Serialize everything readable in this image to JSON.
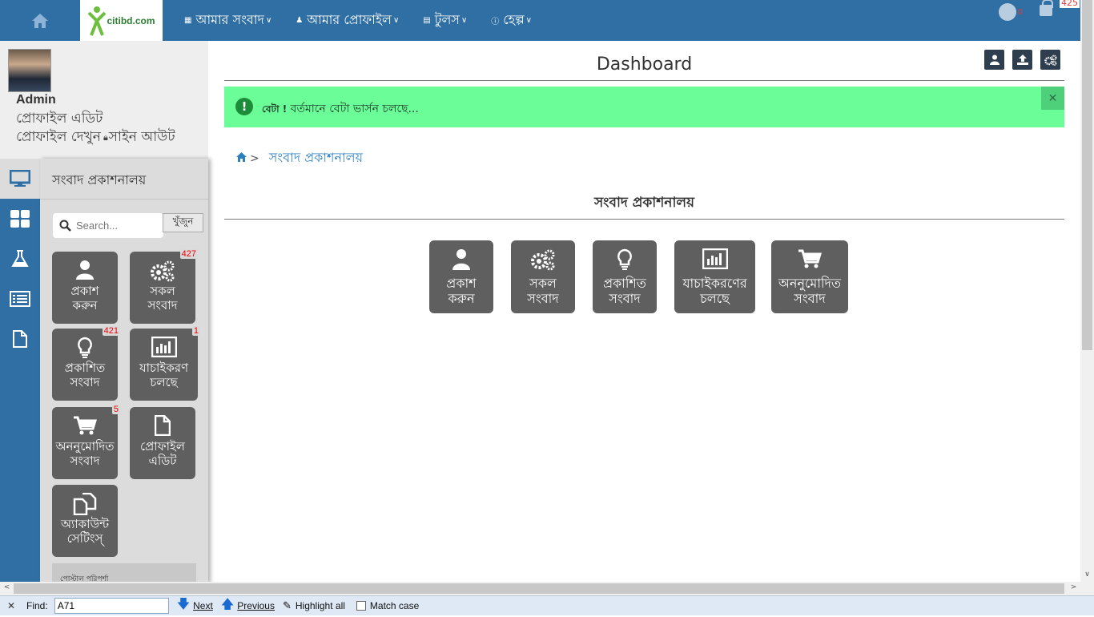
{
  "topbar": {
    "logo_text": "citibd.com",
    "nav": [
      {
        "icon": "grid-icon",
        "label": "আমার সংবাদ"
      },
      {
        "icon": "user-icon",
        "label": "আমার প্রোফাইল"
      },
      {
        "icon": "tools-icon",
        "label": "টুলস"
      },
      {
        "icon": "help-icon",
        "label": "হেল্প"
      }
    ],
    "globe_badge": "0",
    "top_badge": "425"
  },
  "profile": {
    "name": "Admin",
    "edit_link": "প্রোফাইল এডিট",
    "view_link": "প্রোফাইল দেখুন",
    "signout_link": "সাইন আউট"
  },
  "panel": {
    "title": "সংবাদ প্রকাশনালয়",
    "search_placeholder": "Search...",
    "search_button": "খুঁজুন",
    "tiles": [
      {
        "label1": "প্রকাশ",
        "label2": "করুন",
        "badge": ""
      },
      {
        "label1": "সকল",
        "label2": "সংবাদ",
        "badge": "427"
      },
      {
        "label1": "প্রকাশিত",
        "label2": "সংবাদ",
        "badge": "421"
      },
      {
        "label1": "যাচাইকরণ",
        "label2": "চলছে",
        "badge": "1"
      },
      {
        "label1": "অননুমোদিত",
        "label2": "সংবাদ",
        "badge": "5"
      },
      {
        "label1": "প্রোফাইল",
        "label2": "এডিট",
        "badge": ""
      },
      {
        "label1": "অ্যাকাউন্ট",
        "label2": "সেটিংস্",
        "badge": ""
      }
    ],
    "footer_text": "পোস্টাল পরিপর্শা"
  },
  "main": {
    "title": "Dashboard",
    "alert_bold": "বেটা !",
    "alert_text": "বর্তমানে বেটা ভার্সন চলছে...",
    "breadcrumb": "সংবাদ প্রকাশনালয়",
    "section_title": "সংবাদ প্রকাশনালয়",
    "tiles": [
      {
        "label1": "প্রকাশ",
        "label2": "করুন"
      },
      {
        "label1": "সকল",
        "label2": "সংবাদ"
      },
      {
        "label1": "প্রকাশিত",
        "label2": "সংবাদ"
      },
      {
        "label1": "যাচাইকরণের",
        "label2": "চলছে"
      },
      {
        "label1": "অননুমোদিত",
        "label2": "সংবাদ"
      }
    ]
  },
  "findbar": {
    "label": "Find:",
    "value": "A71",
    "next": "Next",
    "previous": "Previous",
    "highlight": "Highlight all",
    "match_case": "Match case"
  }
}
